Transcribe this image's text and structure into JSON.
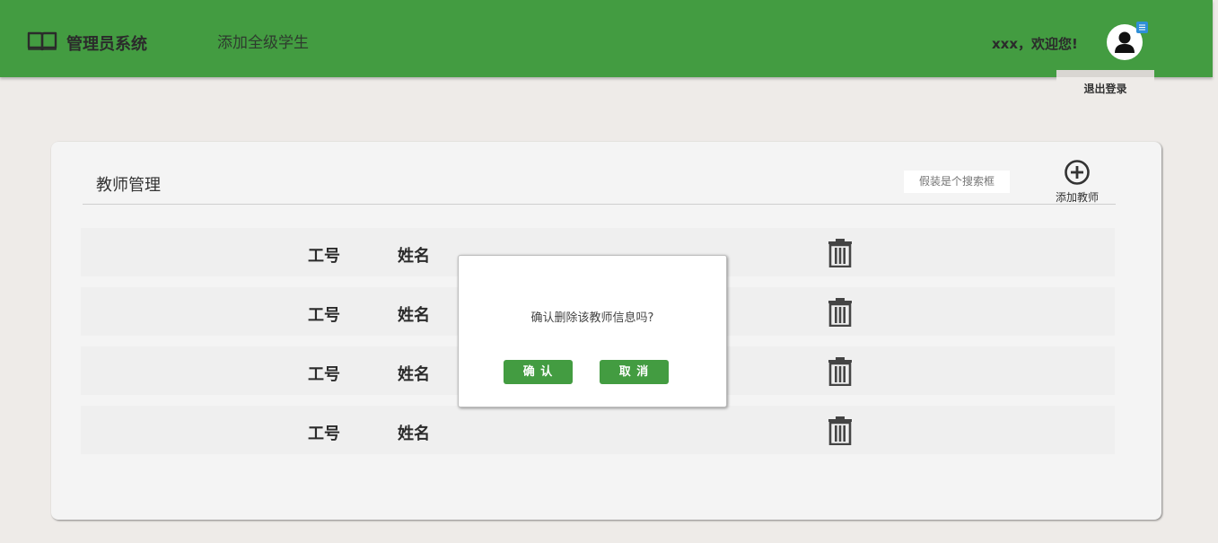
{
  "header": {
    "brand_title": "管理员系统",
    "nav_link": "添加全级学生",
    "welcome": "xxx，欢迎您!",
    "logout": "退出登录",
    "accent_color": "#439c41"
  },
  "panel": {
    "title": "教师管理",
    "search_placeholder": "假装是个搜索框",
    "add_label": "添加教师",
    "rows": [
      {
        "id": "工号",
        "name": "姓名"
      },
      {
        "id": "工号",
        "name": "姓名"
      },
      {
        "id": "工号",
        "name": "姓名"
      },
      {
        "id": "工号",
        "name": "姓名"
      }
    ]
  },
  "dialog": {
    "message": "确认删除该教师信息吗?",
    "confirm_label": "确 认",
    "cancel_label": "取 消"
  },
  "icons": {
    "brand": "book-icon",
    "avatar": "user-icon",
    "menu": "menu-icon",
    "add": "plus-circle-icon",
    "delete": "trash-icon"
  }
}
